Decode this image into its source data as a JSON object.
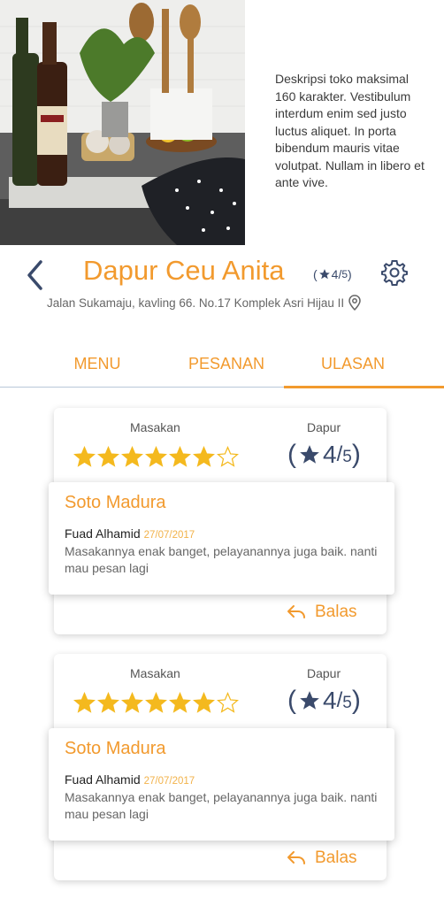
{
  "store": {
    "description": "Deskripsi toko maksimal 160 karakter. Vestibulum interdum enim sed justo luctus aliquet. In porta bibendum mauris vitae volutpat. Nullam in libero et ante vive.",
    "name": "Dapur Ceu Anita",
    "rating": "4",
    "rating_max": "5",
    "address": "Jalan Sukamaju, kavling 66. No.17 Komplek Asri Hijau II"
  },
  "tabs": [
    {
      "label": "MENU"
    },
    {
      "label": "PESANAN"
    },
    {
      "label": "ULASAN"
    }
  ],
  "colors": {
    "accent": "#f29a2e",
    "navy": "#3a4a6b",
    "star": "#f4b91e"
  },
  "reviews": [
    {
      "masakan_label": "Masakan",
      "dapur_label": "Dapur",
      "masakan_stars": 6,
      "masakan_stars_max": 7,
      "dapur_rating": "4",
      "dapur_max": "5",
      "dish": "Soto Madura",
      "user": "Fuad Alhamid",
      "date": "27/07/2017",
      "text": "Masakannya enak banget, pelayanannya juga baik. nanti mau pesan lagi",
      "reply_label": "Balas"
    },
    {
      "masakan_label": "Masakan",
      "dapur_label": "Dapur",
      "masakan_stars": 6,
      "masakan_stars_max": 7,
      "dapur_rating": "4",
      "dapur_max": "5",
      "dish": "Soto Madura",
      "user": "Fuad Alhamid",
      "date": "27/07/2017",
      "text": "Masakannya enak banget, pelayanannya juga baik. nanti mau pesan lagi",
      "reply_label": "Balas"
    }
  ]
}
